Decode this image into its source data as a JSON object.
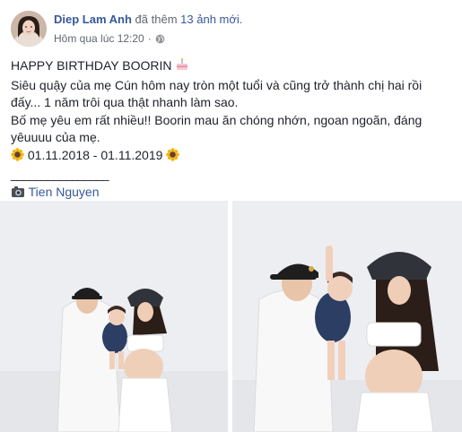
{
  "post": {
    "author_name": "Diep Lam Anh",
    "action_text": "đã thêm",
    "photo_count": "13 ảnh mới.",
    "timestamp": "Hôm qua lúc 12:20",
    "dot_separator": "·",
    "privacy_icon": "globe-icon",
    "lines": [
      "HAPPY BIRTHDAY BOORIN",
      "Siêu quậy của mẹ Cún hôm nay tròn một tuổi và cũng trở thành chị hai rồi đấy... 1 năm trôi qua thật nhanh làm sao.",
      "Bố mẹ yêu em rất nhiều!! Boorin mau ăn chóng nhớn, ngoan ngoãn, đáng yêuuuu của mẹ.",
      "01.11.2018 - 01.11.2019",
      "________________",
      "Tien Nguyen"
    ],
    "emojis": {
      "cake": "cake-icon",
      "sunflower": "sunflower-icon",
      "camera": "camera-icon"
    }
  },
  "colors": {
    "link_blue": "#365899",
    "text": "#1d2129",
    "secondary_text": "#616770"
  }
}
